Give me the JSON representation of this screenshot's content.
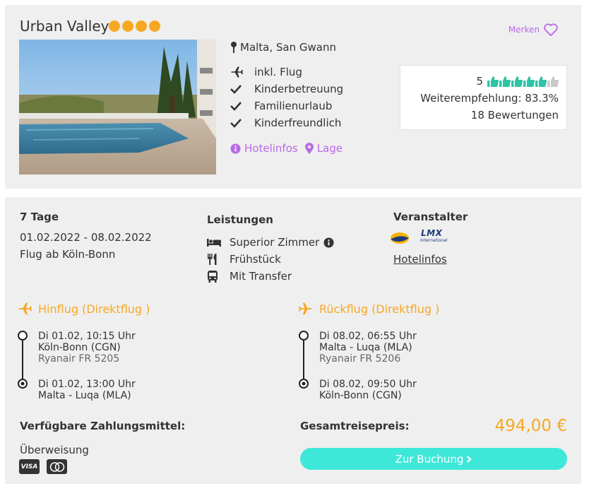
{
  "hotel": {
    "name": "Urban Valley",
    "stars": 4,
    "merken_label": "Merken",
    "location": "Malta, San Gwann",
    "features": [
      "inkl. Flug",
      "Kinderbetreuung",
      "Familienurlaub",
      "Kinderfreundlich"
    ],
    "feature_icons": [
      "plane-icon",
      "check-icon",
      "check-icon",
      "check-icon"
    ],
    "hotelinfos_label": "Hotelinfos",
    "lage_label": "Lage"
  },
  "rating": {
    "score": "5",
    "thumbs_filled": 5,
    "thumbs_total": 6,
    "recommendation": "Weiterempfehlung: 83.3%",
    "reviews": "18 Bewertungen"
  },
  "trip": {
    "duration": "7 Tage",
    "dates": "01.02.2022 - 08.02.2022",
    "departure": "Flug ab Köln-Bonn"
  },
  "services": {
    "heading": "Leistungen",
    "items": [
      "Superior Zimmer",
      "Frühstück",
      "Mit Transfer"
    ],
    "icons": [
      "bed-icon",
      "cutlery-icon",
      "bus-icon"
    ]
  },
  "operator": {
    "heading": "Veranstalter",
    "logo_text": "LMX",
    "logo_sub": "International",
    "link": "Hotelinfos"
  },
  "outbound": {
    "title": "Hinflug (Direktflug )",
    "dep_time": "Di 01.02, 10:15 Uhr",
    "dep_airport": "Köln-Bonn (CGN)",
    "airline": "Ryanair FR 5205",
    "arr_time": "Di 01.02, 13:00 Uhr",
    "arr_airport": "Malta - Luqa (MLA)"
  },
  "return": {
    "title": "Rückflug (Direktflug )",
    "dep_time": "Di 08.02, 06:55 Uhr",
    "dep_airport": "Malta - Luqa (MLA)",
    "airline": "Ryanair FR 5206",
    "arr_time": "Di 08.02, 09:50 Uhr",
    "arr_airport": "Köln-Bonn (CGN)"
  },
  "payment": {
    "heading": "Verfügbare Zahlungsmittel:",
    "method": "Überweisung",
    "cards": [
      "VISA",
      "Mastercard"
    ]
  },
  "price": {
    "label": "Gesamtreisepreis:",
    "value": "494,00 €"
  },
  "booking": {
    "button_label": "Zur Buchung"
  },
  "colors": {
    "accent_orange": "#f7a823",
    "accent_purple": "#b86ae6",
    "accent_teal": "#3ee8d9",
    "thumb_green": "#2ec4a6"
  }
}
